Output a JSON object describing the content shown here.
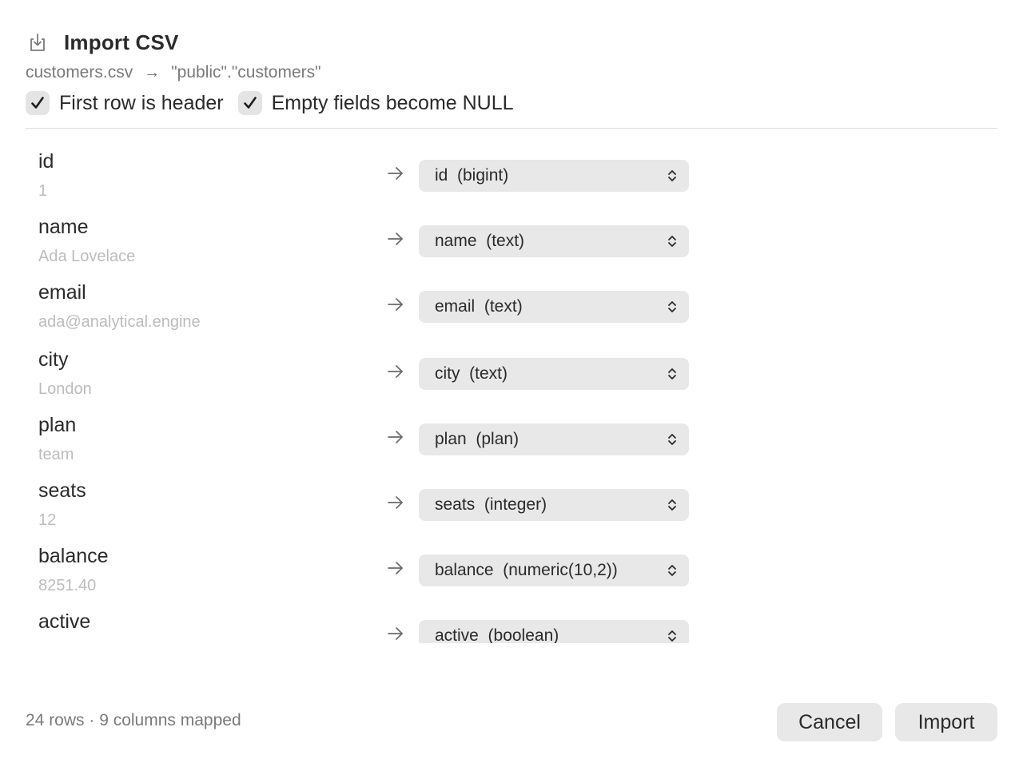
{
  "header": {
    "title": "Import CSV",
    "icon": "import-tray-icon",
    "source_file": "customers.csv",
    "arrow": "→",
    "target_table": "\"public\".\"customers\""
  },
  "options": {
    "first_row_header": {
      "label": "First row is header",
      "checked": true
    },
    "empty_as_null": {
      "label": "Empty fields become NULL",
      "checked": true
    }
  },
  "mappings": [
    {
      "column": "id",
      "sample": "1",
      "target": "id  (bigint)"
    },
    {
      "column": "name",
      "sample": "Ada Lovelace",
      "target": "name  (text)"
    },
    {
      "column": "email",
      "sample": "ada@analytical.engine",
      "target": "email  (text)"
    },
    {
      "column": "city",
      "sample": "London",
      "target": "city  (text)"
    },
    {
      "column": "plan",
      "sample": "team",
      "target": "plan  (plan)"
    },
    {
      "column": "seats",
      "sample": "12",
      "target": "seats  (integer)"
    },
    {
      "column": "balance",
      "sample": "8251.40",
      "target": "balance  (numeric(10,2))"
    },
    {
      "column": "active",
      "sample": "",
      "target": "active  (boolean)"
    }
  ],
  "footer": {
    "status": "24 rows · 9 columns mapped",
    "cancel_label": "Cancel",
    "import_label": "Import"
  },
  "colors": {
    "control_bg": "#e8e8e8",
    "text": "#2a2a2a",
    "muted": "#7a7a7a",
    "sample": "#bcbcbc"
  }
}
